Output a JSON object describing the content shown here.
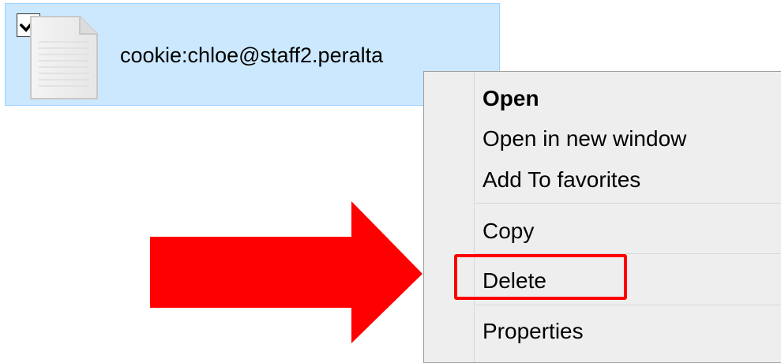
{
  "file": {
    "name": "cookie:chloe@staff2.peralta",
    "checked": true,
    "icon": "document-icon"
  },
  "context_menu": {
    "items": [
      {
        "label": "Open",
        "bold": true
      },
      {
        "label": "Open in new window"
      },
      {
        "label": "Add To favorites"
      },
      {
        "label": "Copy"
      },
      {
        "label": "Delete",
        "highlighted": true
      },
      {
        "label": "Properties"
      }
    ]
  },
  "annotation": {
    "arrow_color": "#ff0000",
    "highlight_color": "#ff0000"
  },
  "colors": {
    "selection_bg": "#cce8ff",
    "selection_border": "#99d1ff",
    "menu_bg": "#eeeeee"
  }
}
